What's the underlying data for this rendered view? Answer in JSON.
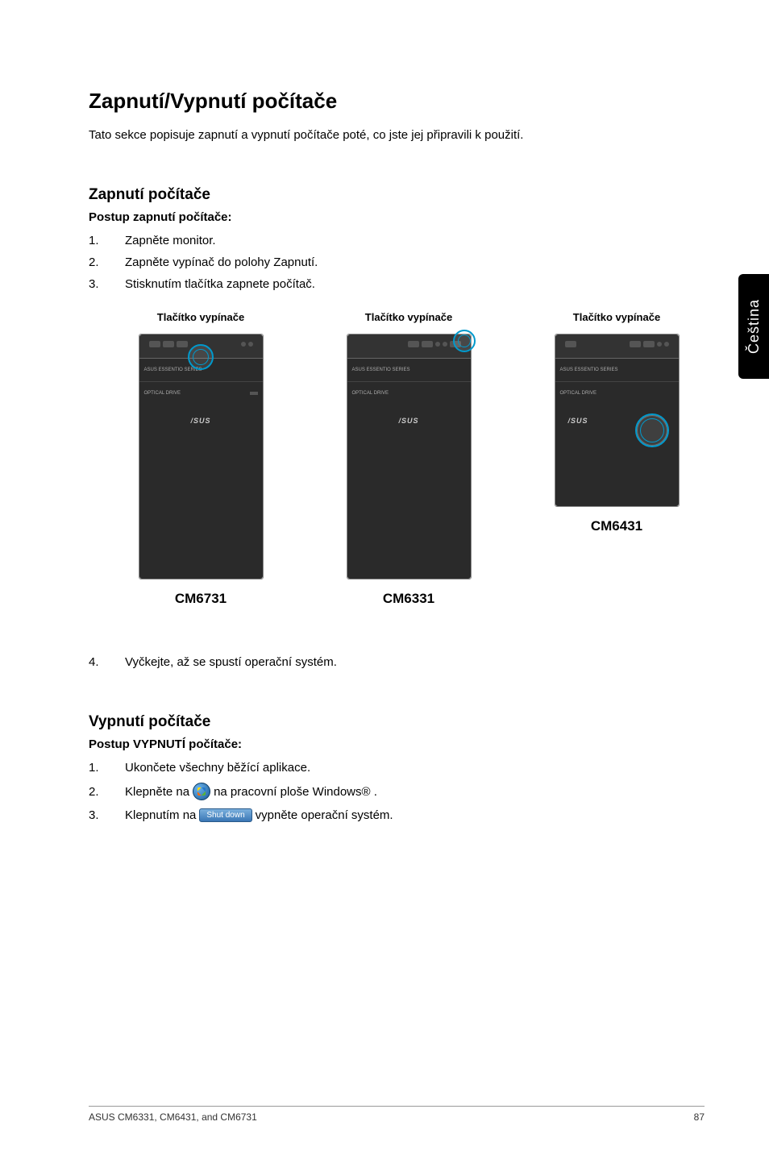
{
  "title": "Zapnutí/Vypnutí počítače",
  "intro": "Tato sekce popisuje zapnutí a vypnutí počítače poté, co jste jej připravili k použití.",
  "powerOn": {
    "heading": "Zapnutí počítače",
    "subheading": "Postup zapnutí počítače:",
    "steps": [
      "Zapněte monitor.",
      "Zapněte vypínač do polohy Zapnutí.",
      "Stisknutím tlačítka zapnete počítač."
    ],
    "afterStep": "Vyčkejte, až se spustí operační systém."
  },
  "diagrams": [
    {
      "label": "Tlačítko vypínače",
      "model": "CM6731",
      "band1": "ASUS ESSENTIO SERIES",
      "band2": "OPTICAL DRIVE",
      "logo": "/SUS"
    },
    {
      "label": "Tlačítko vypínače",
      "model": "CM6331",
      "band1": "ASUS ESSENTIO SERIES",
      "band2": "OPTICAL DRIVE",
      "logo": "/SUS"
    },
    {
      "label": "Tlačítko vypínače",
      "model": "CM6431",
      "band1": "ASUS ESSENTIO SERIES",
      "band2": "OPTICAL DRIVE",
      "logo": "/SUS"
    }
  ],
  "powerOff": {
    "heading": "Vypnutí počítače",
    "subheading": "Postup VYPNUTÍ počítače:",
    "step1": "Ukončete všechny běžící aplikace.",
    "step2_before": "Klepněte na",
    "step2_after": "na pracovní ploše Windows® .",
    "step3_before": "Klepnutím na",
    "step3_button": "Shut down",
    "step3_after": "vypněte operační systém."
  },
  "sideTab": "Čeština",
  "footer": {
    "left": "ASUS CM6331, CM6431, and CM6731",
    "right": "87"
  }
}
